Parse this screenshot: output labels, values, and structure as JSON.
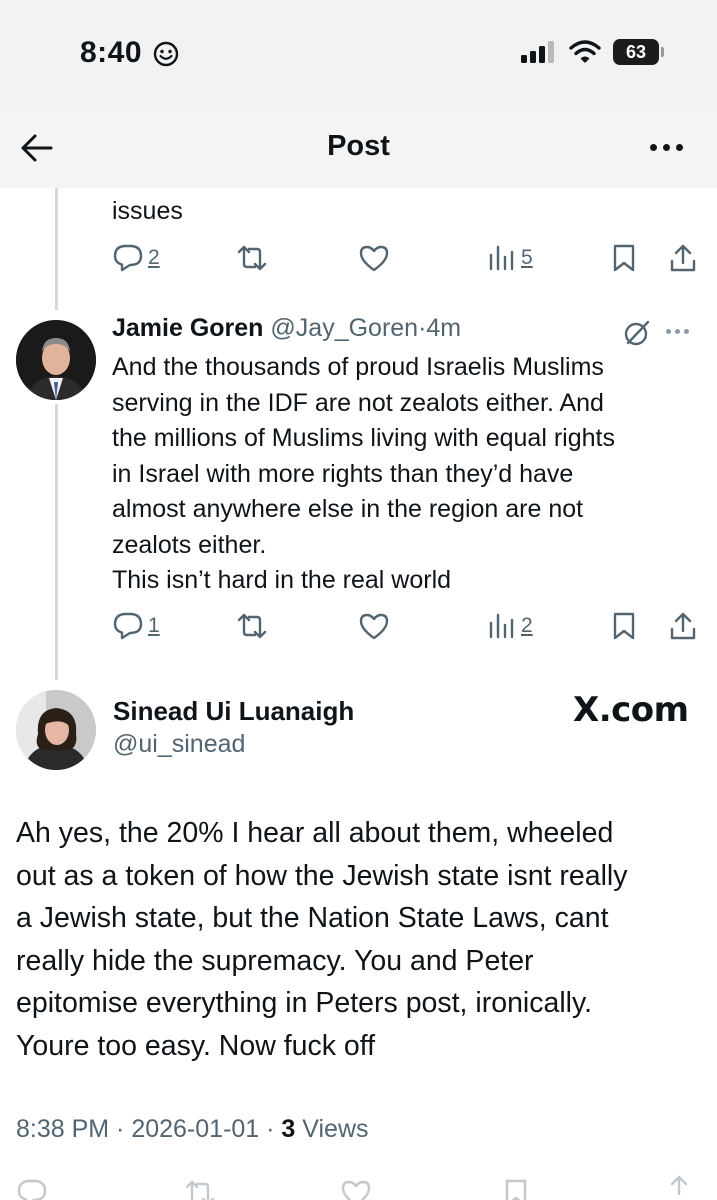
{
  "status_bar": {
    "time": "8:40",
    "battery": "63"
  },
  "nav": {
    "title": "Post"
  },
  "previous_reply": {
    "text_tail": "issues",
    "stats": {
      "replies": "2",
      "views": "5"
    }
  },
  "reply": {
    "author_name": "Jamie Goren",
    "author_handle": "@Jay_Goren",
    "separator": "·",
    "time_ago": "4m",
    "text": "And the thousands of proud Israelis Muslims\nserving in the IDF are not zealots either. And\nthe millions of Muslims living with equal rights\nin Israel with more rights than they’d have\nalmost anywhere else in the region are not\nzealots either.\nThis isn’t hard in the real world",
    "stats": {
      "replies": "1",
      "views": "2"
    }
  },
  "main_post": {
    "author_name": "Sinead Ui Luanaigh",
    "author_handle": "@ui_sinead",
    "watermark": "X.com",
    "text": "Ah yes, the 20% I hear all about them, wheeled\nout as a token of how the Jewish state isnt really\na Jewish state, but the Nation State Laws, cant\nreally hide the supremacy.   You and Peter\nepitomise everything in Peters post, ironically.\nYoure too easy.   Now fuck off",
    "timestamp": "8:38 PM · 2026-01-01 · ",
    "views_count": "3",
    "views_label": " Views"
  },
  "icons": [
    "back-arrow-icon",
    "more-icon",
    "reply-icon",
    "repost-icon",
    "like-icon",
    "views-icon",
    "bookmark-icon",
    "share-icon",
    "grok-icon",
    "smiley-icon",
    "signal-icon",
    "wifi-icon",
    "battery-icon"
  ]
}
